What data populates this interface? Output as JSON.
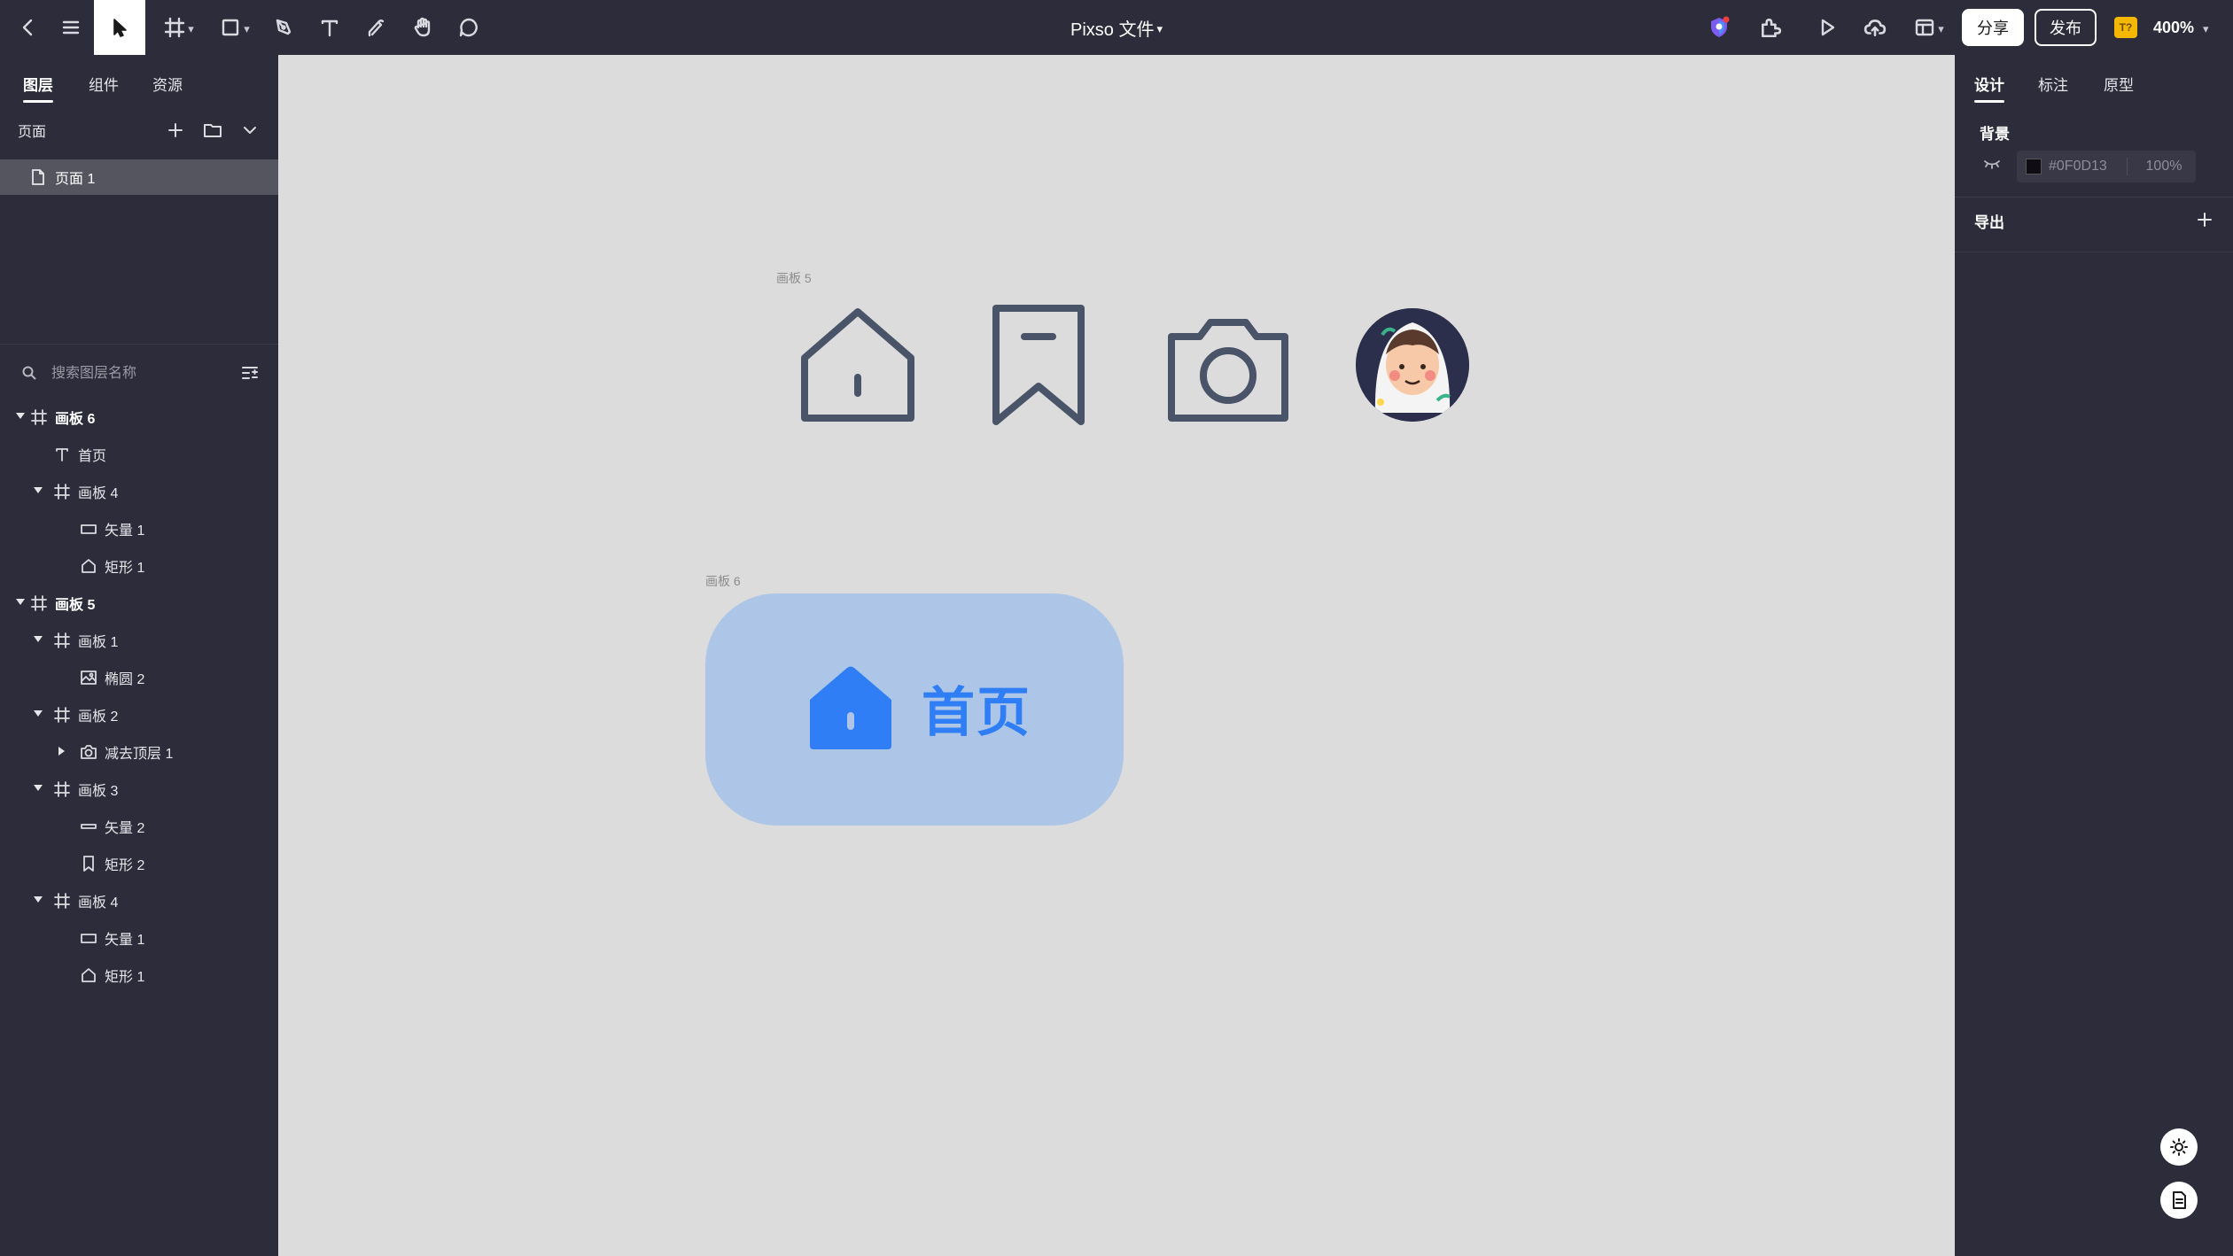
{
  "toolbar": {
    "doc_title": "Pixso 文件",
    "share_label": "分享",
    "publish_label": "发布",
    "font_badge": "T?",
    "zoom_level": "400%",
    "icons": [
      "back-icon",
      "menu-icon",
      "move-tool-icon",
      "frame-tool-icon",
      "shape-tool-icon",
      "pen-tool-icon",
      "text-tool-icon",
      "pencil-tool-icon",
      "hand-tool-icon",
      "comment-tool-icon",
      "team-shield-icon",
      "plugins-icon",
      "play-icon",
      "upload-cloud-icon",
      "layout-icon"
    ]
  },
  "left_panel": {
    "tabs": [
      {
        "label": "图层",
        "active": true
      },
      {
        "label": "组件",
        "active": false
      },
      {
        "label": "资源",
        "active": false
      }
    ],
    "pages_label": "页面",
    "pages": [
      {
        "label": "页面 1",
        "selected": true
      }
    ],
    "search_placeholder": "搜索图层名称",
    "layers": [
      {
        "name": "画板 6",
        "icon": "frame-icon",
        "depth": 0,
        "expand": "down",
        "bold": true
      },
      {
        "name": "首页",
        "icon": "text-icon",
        "depth": 1,
        "expand": "none",
        "bold": false
      },
      {
        "name": "画板 4",
        "icon": "frame-icon",
        "depth": 1,
        "expand": "down",
        "bold": false
      },
      {
        "name": "矢量 1",
        "icon": "rect-icon",
        "depth": 2,
        "expand": "none",
        "bold": false
      },
      {
        "name": "矩形 1",
        "icon": "house-icon",
        "depth": 2,
        "expand": "none",
        "bold": false
      },
      {
        "name": "画板 5",
        "icon": "frame-icon",
        "depth": 0,
        "expand": "down",
        "bold": true
      },
      {
        "name": "画板 1",
        "icon": "frame-icon",
        "depth": 1,
        "expand": "down",
        "bold": false
      },
      {
        "name": "椭圆 2",
        "icon": "image-icon",
        "depth": 2,
        "expand": "none",
        "bold": false
      },
      {
        "name": "画板 2",
        "icon": "frame-icon",
        "depth": 1,
        "expand": "down",
        "bold": false
      },
      {
        "name": "减去顶层 1",
        "icon": "camera-icon",
        "depth": 2,
        "expand": "right",
        "bold": false
      },
      {
        "name": "画板 3",
        "icon": "frame-icon",
        "depth": 1,
        "expand": "down",
        "bold": false
      },
      {
        "name": "矢量 2",
        "icon": "line-rect-icon",
        "depth": 2,
        "expand": "none",
        "bold": false
      },
      {
        "name": "矩形 2",
        "icon": "bookmark-icon",
        "depth": 2,
        "expand": "none",
        "bold": false
      },
      {
        "name": "画板 4",
        "icon": "frame-icon",
        "depth": 1,
        "expand": "down",
        "bold": false
      },
      {
        "name": "矢量 1",
        "icon": "rect-icon",
        "depth": 2,
        "expand": "none",
        "bold": false
      },
      {
        "name": "矩形 1",
        "icon": "house-icon",
        "depth": 2,
        "expand": "none",
        "bold": false
      }
    ]
  },
  "canvas": {
    "background": "#dcdcdc",
    "frame5_label": "画板 5",
    "frame6_label": "画板 6",
    "icon_color": "#4a5468",
    "card": {
      "label": "首页",
      "background": "#adc6e8",
      "accent": "#2f7ef5"
    }
  },
  "right_panel": {
    "tabs": [
      {
        "label": "设计",
        "active": true
      },
      {
        "label": "标注",
        "active": false
      },
      {
        "label": "原型",
        "active": false
      }
    ],
    "background_title": "背景",
    "background_hex": "#0F0D13",
    "background_opacity": "100%",
    "export_title": "导出"
  }
}
